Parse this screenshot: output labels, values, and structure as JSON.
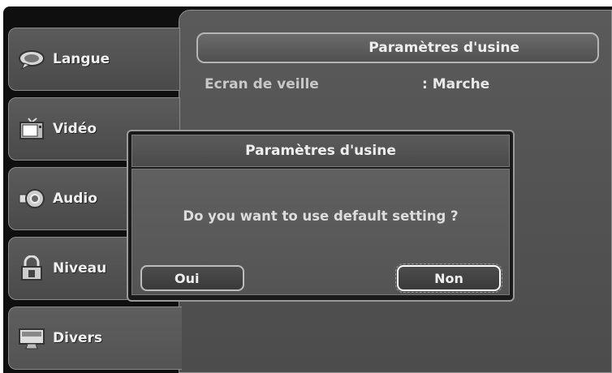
{
  "sidebar": {
    "items": [
      {
        "label": "Langue",
        "icon": "speech-bubble-icon"
      },
      {
        "label": "Vidéo",
        "icon": "tv-icon"
      },
      {
        "label": "Audio",
        "icon": "speaker-icon"
      },
      {
        "label": "Niveau",
        "icon": "lock-icon"
      },
      {
        "label": "Divers",
        "icon": "monitor-icon"
      }
    ],
    "active": "Divers"
  },
  "main": {
    "title": "Paramètres d'usine",
    "settings": [
      {
        "label": "Ecran de veille",
        "value": ": Marche"
      }
    ]
  },
  "dialog": {
    "title": "Paramètres d'usine",
    "message": "Do you want to use default setting ?",
    "yes_label": "Oui",
    "no_label": "Non",
    "focused": "Non"
  }
}
